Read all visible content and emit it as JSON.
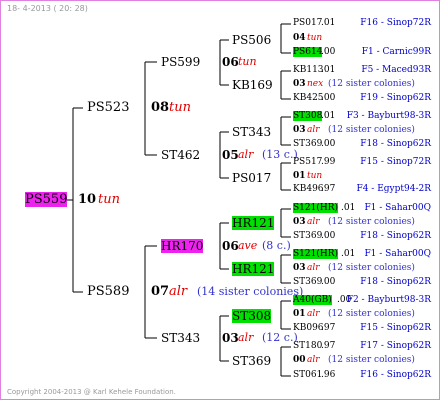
{
  "header": {
    "date_stamp": "18- 4-2013 ( 20: 28)"
  },
  "footer": {
    "copyright": "Copyright 2004-2013 @ Karl Kehele Foundation."
  },
  "colors": {
    "frame": "#e080e0",
    "lines": "#000000",
    "highlight_green": "#00e000",
    "highlight_magenta": "#ee22ee",
    "strain": "#e00000",
    "note": "#3333cc",
    "location": "#0000cc"
  },
  "gen0": {
    "id": "PS559",
    "year": "10",
    "strain": "tun"
  },
  "gen1": [
    {
      "id": "PS523",
      "year": "08",
      "strain": "tun"
    },
    {
      "id": "PS589",
      "year": "07",
      "strain": "alr",
      "note": "(14 sister colonies)"
    }
  ],
  "gen2": [
    {
      "id": "PS599",
      "year": "06",
      "strain": "tun"
    },
    {
      "id": "ST462",
      "year": "05",
      "strain": "alr",
      "note": "(13 c.)"
    },
    {
      "id": "HR170",
      "year": "06",
      "strain": "ave",
      "note": "(8 c.)"
    },
    {
      "id": "ST343",
      "year": "03",
      "strain": "alr",
      "note": "(12 c.)"
    }
  ],
  "gen3": [
    {
      "id": "PS506",
      "year": "04",
      "strain": "tun"
    },
    {
      "id": "KB169"
    },
    {
      "id": "ST343"
    },
    {
      "id": "PS017",
      "year": "01",
      "strain": "tun"
    },
    {
      "id": "HR121"
    },
    {
      "id": "HR121"
    },
    {
      "id": "ST308"
    },
    {
      "id": "ST369"
    }
  ],
  "gen4": [
    {
      "id": "PS017",
      "year": ".01",
      "loc": "F16 - Sinop72R"
    },
    {
      "id": "PS614",
      "year": ".00",
      "loc": "F1 - Carnic99R"
    },
    {
      "id": "KB113",
      "year": ".01",
      "loc": "F5 - Maced93R"
    },
    {
      "id": "KB425",
      "year": ".00",
      "loc": "F19 - Sinop62R"
    },
    {
      "id": "ST308",
      "year": ".01",
      "loc": "F3 - Bayburt98-3R"
    },
    {
      "id": "ST369",
      "year": ".00",
      "loc": "F18 - Sinop62R"
    },
    {
      "id": "PS517",
      "year": ".99",
      "loc": "F15 - Sinop72R"
    },
    {
      "id": "KB496",
      "year": ".97",
      "loc": "F4 - Egypt94-2R"
    },
    {
      "id": "S121(HR)",
      "year": ".01",
      "loc": "F1 - Sahar00Q"
    },
    {
      "id": "ST369",
      "year": ".00",
      "loc": "F18 - Sinop62R"
    },
    {
      "id": "S121(HR)",
      "year": ".01",
      "loc": "F1 - Sahar00Q"
    },
    {
      "id": "ST369",
      "year": ".00",
      "loc": "F18 - Sinop62R"
    },
    {
      "id": "A40(GB)",
      "year": ".00",
      "loc": "F2 - Bayburt98-3R"
    },
    {
      "id": "KB096",
      "year": ".97",
      "loc": "F15 - Sinop62R"
    },
    {
      "id": "ST180",
      "year": ".97",
      "loc": "F17 - Sinop62R"
    },
    {
      "id": "ST061",
      "year": ".96",
      "loc": "F16 - Sinop62R"
    }
  ],
  "gen4_mid": [
    {
      "year": "04",
      "strain": "tun"
    },
    {
      "year": "03",
      "strain": "nex",
      "note": "(12 sister colonies)"
    },
    {
      "year": "03",
      "strain": "alr",
      "note": "(12 sister colonies)"
    },
    {
      "year": "01",
      "strain": "tun"
    },
    {
      "year": "03",
      "strain": "alr",
      "note": "(12 sister colonies)"
    },
    {
      "year": "03",
      "strain": "alr",
      "note": "(12 sister colonies)"
    },
    {
      "year": "01",
      "strain": "alr",
      "note": "(12 sister colonies)"
    },
    {
      "year": "00",
      "strain": "alr",
      "note": "(12 sister colonies)"
    }
  ]
}
